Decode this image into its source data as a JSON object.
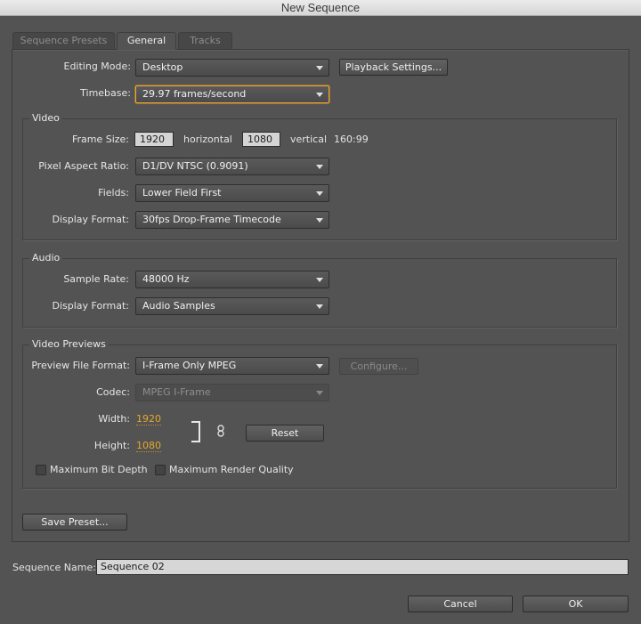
{
  "window": {
    "title": "New Sequence"
  },
  "tabs": [
    {
      "label": "Sequence Presets",
      "active": false
    },
    {
      "label": "General",
      "active": true
    },
    {
      "label": "Tracks",
      "active": false
    }
  ],
  "general": {
    "editing_mode": {
      "label": "Editing Mode:",
      "value": "Desktop"
    },
    "playback_settings_label": "Playback Settings...",
    "timebase": {
      "label": "Timebase:",
      "value": "29.97 frames/second"
    }
  },
  "video": {
    "title": "Video",
    "frame_size_label": "Frame Size:",
    "horizontal_value": "1920",
    "horizontal_label": "horizontal",
    "vertical_value": "1080",
    "vertical_label": "vertical",
    "aspect": "160:99",
    "pixel_aspect": {
      "label": "Pixel Aspect Ratio:",
      "value": "D1/DV NTSC (0.9091)"
    },
    "fields": {
      "label": "Fields:",
      "value": "Lower Field First"
    },
    "display_format": {
      "label": "Display Format:",
      "value": "30fps Drop-Frame Timecode"
    }
  },
  "audio": {
    "title": "Audio",
    "sample_rate": {
      "label": "Sample Rate:",
      "value": "48000 Hz"
    },
    "display_format": {
      "label": "Display Format:",
      "value": "Audio Samples"
    }
  },
  "previews": {
    "title": "Video Previews",
    "file_format": {
      "label": "Preview File Format:",
      "value": "I-Frame Only MPEG"
    },
    "configure_label": "Configure...",
    "codec": {
      "label": "Codec:",
      "value": "MPEG I-Frame"
    },
    "width": {
      "label": "Width:",
      "value": "1920"
    },
    "height": {
      "label": "Height:",
      "value": "1080"
    },
    "reset_label": "Reset",
    "max_bit_depth": {
      "label": "Maximum Bit Depth",
      "checked": false
    },
    "max_render_quality": {
      "label": "Maximum Render Quality",
      "checked": false
    }
  },
  "save_preset_label": "Save Preset...",
  "sequence_name": {
    "label": "Sequence Name:",
    "value": "Sequence 02"
  },
  "footer": {
    "cancel_label": "Cancel",
    "ok_label": "OK"
  },
  "colors": {
    "background": "#535353",
    "accent": "#e3a82c",
    "focus": "#e0a64a"
  }
}
